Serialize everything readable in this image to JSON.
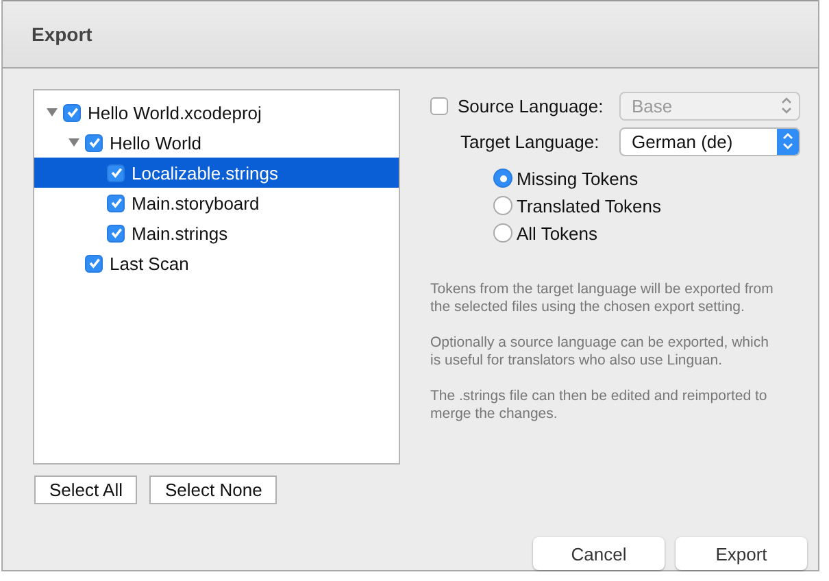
{
  "window": {
    "title": "Export"
  },
  "tree": [
    {
      "label": "Hello World.xcodeproj",
      "checked": true,
      "selected": false,
      "expanded": true,
      "children": [
        {
          "label": "Hello World",
          "checked": true,
          "selected": false,
          "expanded": true,
          "children": [
            {
              "label": "Localizable.strings",
              "checked": true,
              "selected": true
            },
            {
              "label": "Main.storyboard",
              "checked": true,
              "selected": false
            },
            {
              "label": "Main.strings",
              "checked": true,
              "selected": false
            }
          ]
        },
        {
          "label": "Last Scan",
          "checked": true,
          "selected": false
        }
      ]
    }
  ],
  "tree_buttons": [
    "Select All",
    "Select None"
  ],
  "source_language": {
    "label": "Source Language:",
    "checked": false,
    "value": "Base",
    "disabled": true
  },
  "target_language": {
    "label": "Target Language:",
    "value": "German (de)"
  },
  "token_options": [
    {
      "label": "Missing Tokens",
      "selected": true
    },
    {
      "label": "Translated Tokens",
      "selected": false
    },
    {
      "label": "All Tokens",
      "selected": false
    }
  ],
  "help": [
    "Tokens from the target language will be exported from the selected files using the chosen export setting.",
    "Optionally a source language can be exported, which is useful for translators who also use Linguan.",
    "The .strings file can then be edited and reimported to merge the changes."
  ],
  "buttons": [
    "Cancel",
    "Export"
  ]
}
